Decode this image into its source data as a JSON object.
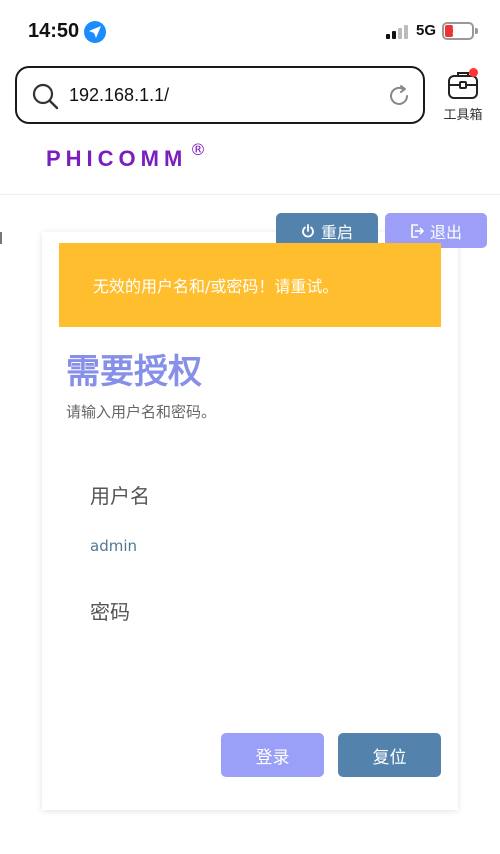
{
  "status_bar": {
    "time": "14:50",
    "network": "5G",
    "battery": "17",
    "battery_fraction": 0.17,
    "location_icon": "location-arrow-icon",
    "signal_icon": "signal-bars-icon"
  },
  "browser": {
    "url": "192.168.1.1/",
    "search_icon": "search-icon",
    "reload_icon": "reload-icon",
    "toolbox_label": "工具箱",
    "toolbox_icon": "toolbox-icon"
  },
  "brand": {
    "name": "PHICOMM",
    "registered": "®",
    "color": "#7a1fbf"
  },
  "actions": {
    "reboot_label": "重启",
    "logout_label": "退出",
    "reboot_icon": "power-icon",
    "logout_icon": "logout-icon"
  },
  "login": {
    "alert": "无效的用户名和/或密码！请重试。",
    "title": "需要授权",
    "subtitle": "请输入用户名和密码。",
    "username_label": "用户名",
    "username_value": "admin",
    "password_label": "密码",
    "password_value": "",
    "login_button": "登录",
    "reset_button": "复位"
  },
  "colors": {
    "alert": "#ffbe2e",
    "primary": "#9a9ff7",
    "secondary": "#5383ad",
    "title": "#8790e8"
  }
}
